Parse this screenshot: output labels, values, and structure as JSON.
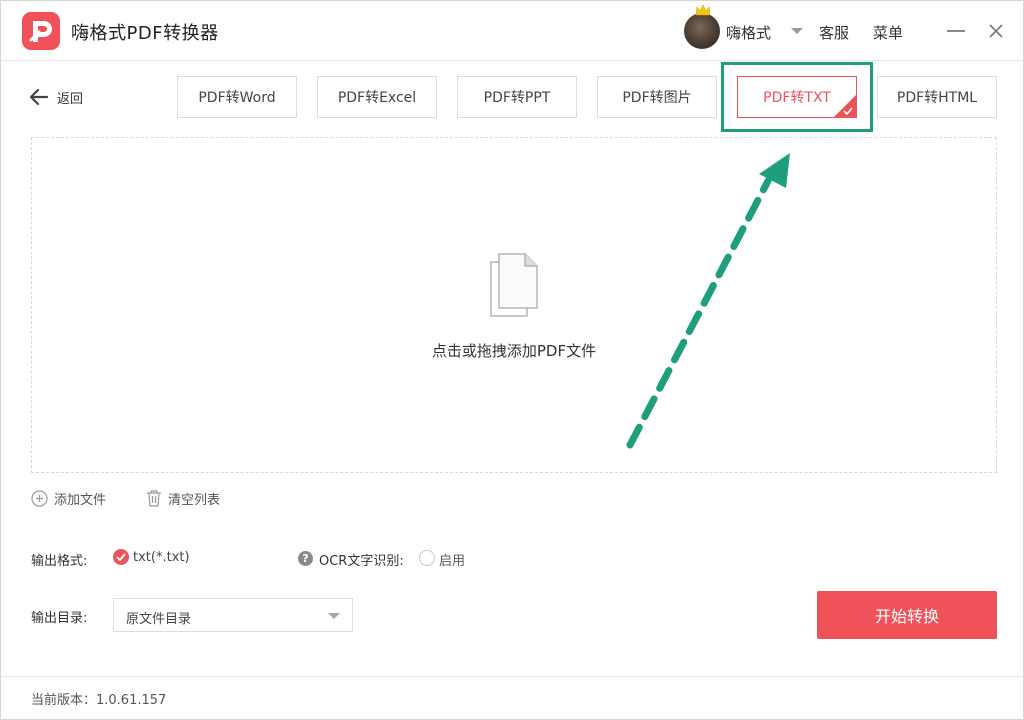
{
  "app": {
    "title": "嗨格式PDF转换器",
    "accent_color": "#f0525a",
    "highlight_color": "#1f9e7e"
  },
  "header": {
    "username": "嗨格式",
    "service_label": "客服",
    "menu_label": "菜单",
    "icons": [
      "app-logo-icon",
      "avatar",
      "crown-icon",
      "chevron-down-icon",
      "minimize-icon",
      "close-icon"
    ]
  },
  "nav": {
    "back_label": "返回",
    "tabs": [
      {
        "label": "PDF转Word",
        "active": false
      },
      {
        "label": "PDF转Excel",
        "active": false
      },
      {
        "label": "PDF转PPT",
        "active": false
      },
      {
        "label": "PDF转图片",
        "active": false
      },
      {
        "label": "PDF转TXT",
        "active": true
      },
      {
        "label": "PDF转HTML",
        "active": false
      }
    ]
  },
  "dropzone": {
    "hint": "点击或拖拽添加PDF文件",
    "icon": "file-stack-icon"
  },
  "file_actions": {
    "add_label": "添加文件",
    "clear_label": "清空列表"
  },
  "settings": {
    "format_label": "输出格式:",
    "format_value": "txt(*.txt)",
    "ocr_help": "?",
    "ocr_label": "OCR文字识别:",
    "ocr_enable_label": "启用",
    "ocr_enabled": false,
    "dir_label": "输出目录:",
    "dir_value": "原文件目录"
  },
  "actions": {
    "start_label": "开始转换"
  },
  "footer": {
    "version": "当前版本：1.0.61.157"
  }
}
